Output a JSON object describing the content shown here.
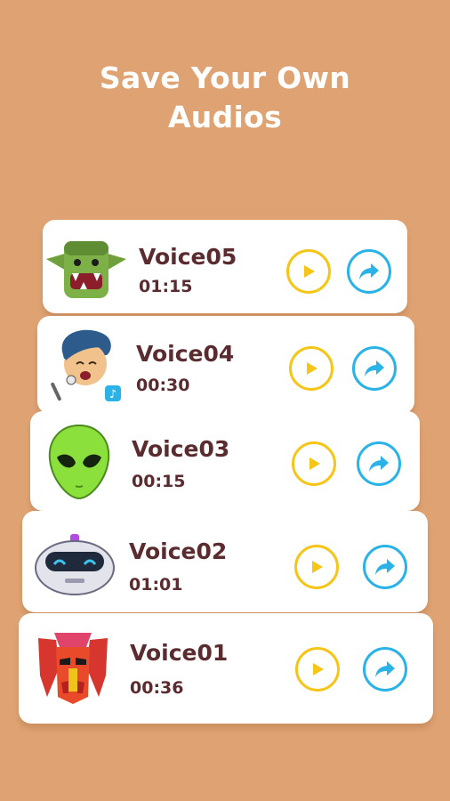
{
  "heading": {
    "line1": "Save Your Own",
    "line2": "Audios"
  },
  "colors": {
    "background": "#DFA373",
    "card": "#FFFFFF",
    "text": "#5B2C2F",
    "play_accent": "#F5C518",
    "share_accent": "#2BB3E8"
  },
  "voices": [
    {
      "name": "Voice05",
      "duration": "01:15",
      "avatar_icon": "orc-avatar-icon",
      "play_icon": "play-icon",
      "share_icon": "share-icon"
    },
    {
      "name": "Voice04",
      "duration": "00:30",
      "avatar_icon": "boy-singing-avatar-icon",
      "play_icon": "play-icon",
      "share_icon": "share-icon"
    },
    {
      "name": "Voice03",
      "duration": "00:15",
      "avatar_icon": "alien-avatar-icon",
      "play_icon": "play-icon",
      "share_icon": "share-icon"
    },
    {
      "name": "Voice02",
      "duration": "01:01",
      "avatar_icon": "robot-avatar-icon",
      "play_icon": "play-icon",
      "share_icon": "share-icon"
    },
    {
      "name": "Voice01",
      "duration": "00:36",
      "avatar_icon": "transformer-mask-avatar-icon",
      "play_icon": "play-icon",
      "share_icon": "share-icon"
    }
  ]
}
